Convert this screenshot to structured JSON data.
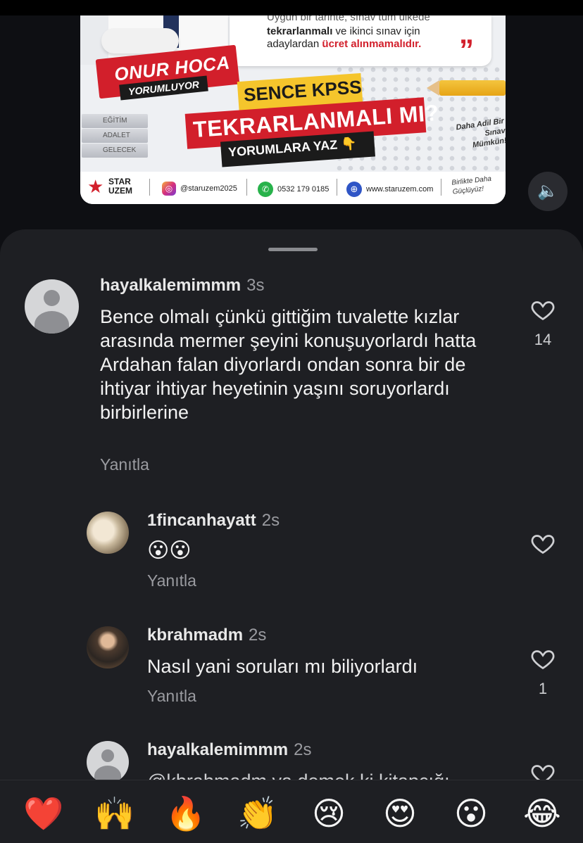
{
  "post": {
    "quote_line1": "Uygun bir tarihte, sınav tüm ülkede",
    "quote_line2_bold": "tekrarlanmalı",
    "quote_line2_rest": " ve ikinci sınav için",
    "quote_line3_start": "adaylardan ",
    "quote_line3_red": "ücret alınmamalıdır.",
    "quote_mark": "”",
    "hoca_title": "ONUR HOCA",
    "hoca_subtitle": "YORUMLUYOR",
    "books": [
      "EĞİTİM",
      "ADALET",
      "GELECEK"
    ],
    "sence": "SENCE KPSS",
    "tekrarlanmali": "TEKRARLANMALI MI?",
    "yorumlara": "YORUMLARA YAZ 👇",
    "daha_adil": "Daha Adil Bir Sınav Mümkün!",
    "footer": {
      "brand_top": "STAR",
      "brand_bottom": "UZEM",
      "instagram": "@staruzem2025",
      "phone": "0532 179 0185",
      "website": "www.staruzem.com",
      "birlikte": "Birlikte Daha Güçlüyüz!"
    }
  },
  "sound_icon": "🔈",
  "comments": [
    {
      "username": "hayalkalemimmm",
      "time": "3s",
      "text": "Bence olmalı çünkü gittiğim tuvalette kızlar arasında mermer şeyini konuşuyorlardı hatta Ardahan falan diyorlardı ondan sonra bir de ihtiyar ihtiyar heyetinin yaşını soruyorlardı birbirlerine",
      "reply": "Yanıtla",
      "likes": "14"
    },
    {
      "username": "1fincanhayatt",
      "time": "2s",
      "text": "😮😮",
      "reply": "Yanıtla",
      "likes": ""
    },
    {
      "username": "kbrahmadm",
      "time": "2s",
      "text": "Nasıl yani soruları mı biliyorlardı",
      "reply": "Yanıtla",
      "likes": "1"
    },
    {
      "username": "hayalkalemimmm",
      "time": "2s",
      "text": "@kbrahmadm ya demek ki kitapçığı",
      "reply": "",
      "likes": ""
    }
  ],
  "reactions": [
    "❤️",
    "🙌",
    "🔥",
    "👏",
    "😢",
    "😍",
    "😮",
    "😂"
  ],
  "colors": {
    "background": "#0e0f13",
    "sheet": "#1e1f23",
    "accent_red": "#d21f2b",
    "accent_yellow": "#f5c52c"
  }
}
